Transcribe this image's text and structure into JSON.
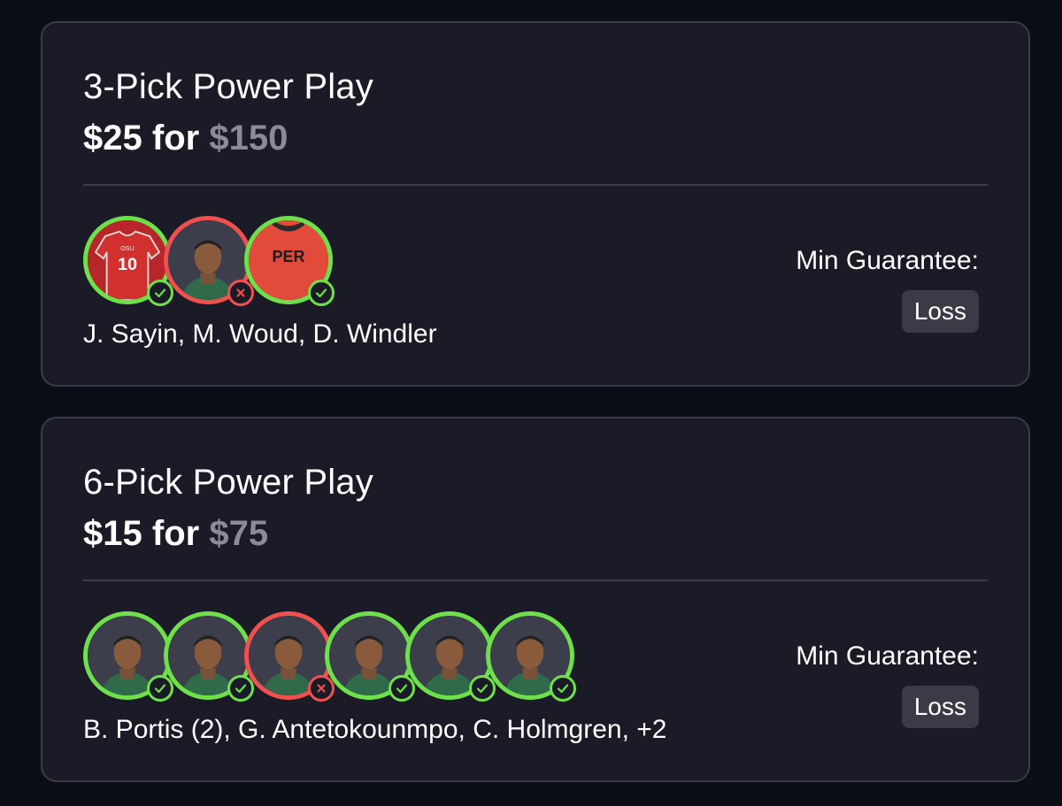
{
  "entries": [
    {
      "title": "3-Pick Power Play",
      "entry_amount": "$25",
      "connector": "for",
      "payout": "$150",
      "min_label": "Min Guarantee:",
      "result": "Loss",
      "players_summary": "J. Sayin, M. Woud, D. Windler",
      "picks": [
        {
          "status": "hit",
          "image": "jersey-red-10",
          "jersey_text": "10",
          "jersey_team": "OSU"
        },
        {
          "status": "miss",
          "image": "player-headshot"
        },
        {
          "status": "hit",
          "image": "jersey-red-per",
          "jersey_text": "PER"
        }
      ]
    },
    {
      "title": "6-Pick Power Play",
      "entry_amount": "$15",
      "connector": "for",
      "payout": "$75",
      "min_label": "Min Guarantee:",
      "result": "Loss",
      "players_summary": "B. Portis (2), G. Antetokounmpo, C. Holmgren, +2",
      "picks": [
        {
          "status": "hit",
          "image": "player-headshot"
        },
        {
          "status": "hit",
          "image": "player-headshot"
        },
        {
          "status": "miss",
          "image": "player-headshot"
        },
        {
          "status": "hit",
          "image": "player-headshot"
        },
        {
          "status": "hit",
          "image": "player-headshot"
        },
        {
          "status": "hit",
          "image": "player-headshot"
        }
      ]
    }
  ],
  "colors": {
    "hit": "#6ee04a",
    "miss": "#f0504e",
    "payout_muted": "#8a8b96",
    "card_bg": "#1a1b26",
    "page_bg": "#0c0e17"
  },
  "icons": {
    "hit": "check-icon",
    "miss": "x-icon"
  }
}
